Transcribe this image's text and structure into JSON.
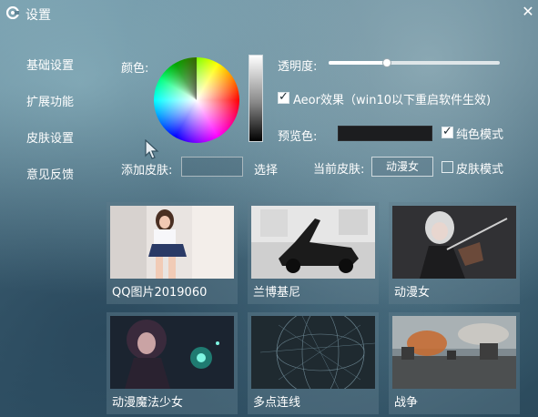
{
  "window": {
    "title": "设置",
    "close_symbol": "✕"
  },
  "sidebar": {
    "items": [
      {
        "label": "基础设置"
      },
      {
        "label": "扩展功能"
      },
      {
        "label": "皮肤设置"
      },
      {
        "label": "意见反馈"
      }
    ]
  },
  "settings": {
    "color_label": "颜色:",
    "opacity_label": "透明度:",
    "opacity_value": 0.34,
    "aero_label": "Aeor效果（win10以下重启软件生效)",
    "aero_checked": true,
    "preview_label": "预览色:",
    "preview_color": "#1c1d1f",
    "solid_mode_label": "纯色模式",
    "solid_mode_checked": true,
    "add_skin_label": "添加皮肤:",
    "add_skin_value": "",
    "choose_label": "选择",
    "current_skin_label": "当前皮肤:",
    "current_skin_value": "动漫女",
    "skin_mode_label": "皮肤模式",
    "skin_mode_checked": false
  },
  "skins": [
    {
      "caption": "QQ图片2019060"
    },
    {
      "caption": "兰博基尼"
    },
    {
      "caption": "动漫女"
    },
    {
      "caption": "动漫魔法少女"
    },
    {
      "caption": "多点连线"
    },
    {
      "caption": "战争"
    }
  ]
}
